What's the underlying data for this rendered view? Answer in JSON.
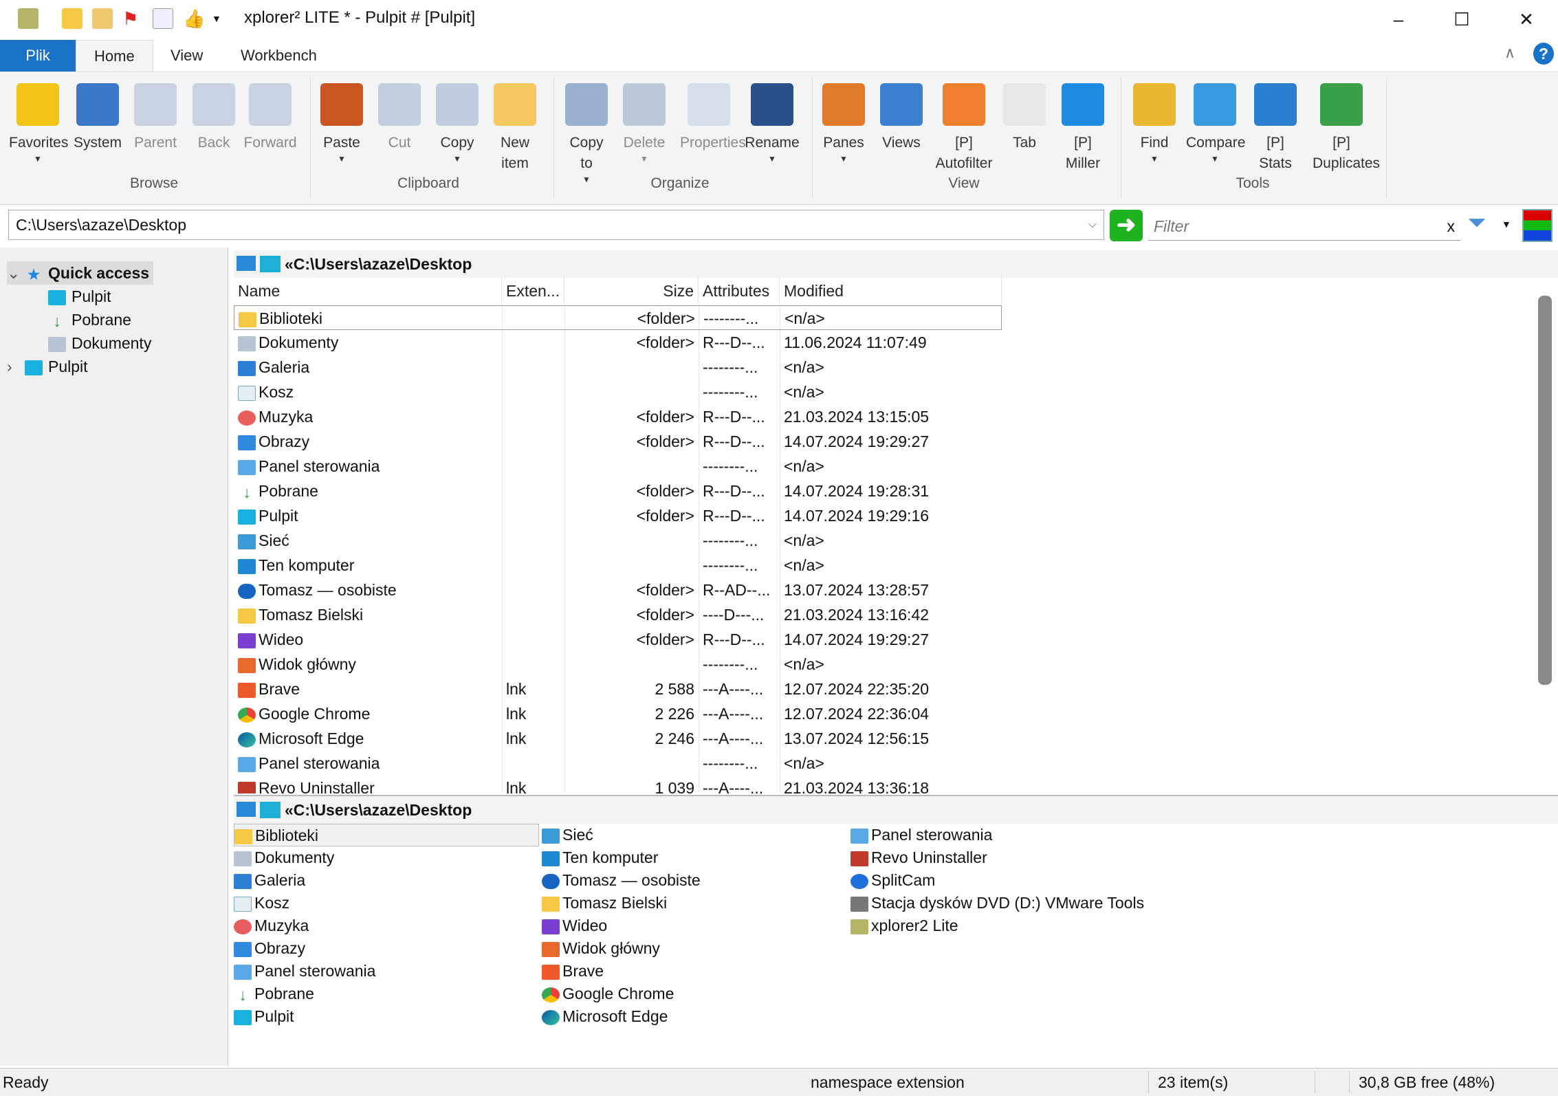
{
  "window": {
    "title": "xplorer² LITE * - Pulpit # [Pulpit]",
    "minimize": "–",
    "maximize": "☐",
    "close": "✕"
  },
  "tabs": [
    {
      "label": "Plik"
    },
    {
      "label": "Home",
      "active": true
    },
    {
      "label": "View"
    },
    {
      "label": "Workbench"
    }
  ],
  "ribbon": {
    "buttons": [
      {
        "label": "Favorites",
        "icon": "star-icon",
        "color": "#f2c418",
        "dropdown": true,
        "enabled": true
      },
      {
        "label": "System",
        "icon": "windows-icon",
        "color": "#3c78c8",
        "enabled": true
      },
      {
        "label": "Parent",
        "icon": "up-arrow-icon",
        "color": "#a8b8d0",
        "enabled": false
      },
      {
        "label": "Back",
        "icon": "back-arrow-icon",
        "color": "#a8b8d0",
        "enabled": false
      },
      {
        "label": "Forward",
        "icon": "forward-arrow-icon",
        "color": "#a8b8d0",
        "enabled": false
      },
      {
        "label": "Paste",
        "icon": "clipboard-icon",
        "color": "#c8561e",
        "dropdown": true,
        "enabled": true
      },
      {
        "label": "Cut",
        "icon": "scissors-icon",
        "color": "#9ab0cc",
        "enabled": false
      },
      {
        "label": "Copy",
        "icon": "copy-icon",
        "color": "#c0cde0",
        "dropdown": true,
        "enabled": true
      },
      {
        "label": "New\nitem",
        "icon": "new-folder-icon",
        "color": "#f5c860",
        "enabled": true
      },
      {
        "label": "Copy\nto",
        "icon": "copy-to-icon",
        "color": "#9ab0cc",
        "dropdown": true,
        "enabled": true
      },
      {
        "label": "Delete",
        "icon": "delete-x-icon",
        "color": "#8ea2c0",
        "dropdown": true,
        "enabled": false
      },
      {
        "label": "Properties",
        "icon": "properties-icon",
        "color": "#c0cde0",
        "enabled": false
      },
      {
        "label": "Rename",
        "icon": "rename-icon",
        "color": "#2a4f8a",
        "dropdown": true,
        "enabled": true
      },
      {
        "label": "Panes",
        "icon": "panes-icon",
        "color": "#e07a2a",
        "dropdown": true,
        "enabled": true
      },
      {
        "label": "Views",
        "icon": "views-icon",
        "color": "#3b7fd0",
        "enabled": true
      },
      {
        "label": "[P]\nAutofilter",
        "icon": "autofilter-icon",
        "color": "#f08030",
        "enabled": true
      },
      {
        "label": "Tab",
        "icon": "tab-icon",
        "color": "#e8e8e8",
        "enabled": true
      },
      {
        "label": "[P]\nMiller",
        "icon": "miller-icon",
        "color": "#1e8ae0",
        "enabled": true
      },
      {
        "label": "Find",
        "icon": "binoculars-icon",
        "color": "#e8b830",
        "dropdown": true,
        "enabled": true
      },
      {
        "label": "Compare",
        "icon": "compare-icon",
        "color": "#3a9ae0",
        "dropdown": true,
        "enabled": true
      },
      {
        "label": "[P]\nStats",
        "icon": "stats-pie-icon",
        "color": "#2a7fd0",
        "enabled": true
      },
      {
        "label": "[P]\nDuplicates",
        "icon": "duplicates-icon",
        "color": "#3aa04a",
        "enabled": true
      }
    ],
    "groups": [
      "Browse",
      "Clipboard",
      "Organize",
      "View",
      "Tools"
    ]
  },
  "address": {
    "value": "C:\\Users\\azaze\\Desktop"
  },
  "filter": {
    "placeholder": "Filter",
    "clear": "x"
  },
  "tree": [
    {
      "label": "Quick access",
      "icon": "star",
      "expander": "⌄",
      "bold": true,
      "selected": true
    },
    {
      "label": "Pulpit",
      "icon": "desktop",
      "child": true
    },
    {
      "label": "Pobrane",
      "icon": "download",
      "child": true
    },
    {
      "label": "Dokumenty",
      "icon": "doc",
      "child": true
    },
    {
      "label": "Pulpit",
      "icon": "desktop",
      "expander": "›"
    }
  ],
  "top_pane": {
    "path": "«C:\\Users\\azaze\\Desktop",
    "columns": [
      "Name",
      "Exten...",
      "Size",
      "Attributes",
      "Modified"
    ],
    "rows": [
      {
        "name": "Biblioteki",
        "icon": "folder",
        "ext": "",
        "size": "<folder>",
        "attr": "--------...",
        "modified": "<n/a>",
        "selected": true
      },
      {
        "name": "Dokumenty",
        "icon": "doc",
        "ext": "",
        "size": "<folder>",
        "attr": "R---D--...",
        "modified": "11.06.2024 11:07:49"
      },
      {
        "name": "Galeria",
        "icon": "gallery",
        "ext": "",
        "size": "",
        "attr": "--------...",
        "modified": "<n/a>"
      },
      {
        "name": "Kosz",
        "icon": "bin",
        "ext": "",
        "size": "",
        "attr": "--------...",
        "modified": "<n/a>"
      },
      {
        "name": "Muzyka",
        "icon": "music",
        "ext": "",
        "size": "<folder>",
        "attr": "R---D--...",
        "modified": "21.03.2024 13:15:05"
      },
      {
        "name": "Obrazy",
        "icon": "pictures",
        "ext": "",
        "size": "<folder>",
        "attr": "R---D--...",
        "modified": "14.07.2024 19:29:27"
      },
      {
        "name": "Panel sterowania",
        "icon": "control",
        "ext": "",
        "size": "",
        "attr": "--------...",
        "modified": "<n/a>"
      },
      {
        "name": "Pobrane",
        "icon": "download",
        "ext": "",
        "size": "<folder>",
        "attr": "R---D--...",
        "modified": "14.07.2024 19:28:31"
      },
      {
        "name": "Pulpit",
        "icon": "desktop",
        "ext": "",
        "size": "<folder>",
        "attr": "R---D--...",
        "modified": "14.07.2024 19:29:16"
      },
      {
        "name": "Sieć",
        "icon": "network",
        "ext": "",
        "size": "",
        "attr": "--------...",
        "modified": "<n/a>"
      },
      {
        "name": "Ten komputer",
        "icon": "pc",
        "ext": "",
        "size": "",
        "attr": "--------...",
        "modified": "<n/a>"
      },
      {
        "name": "Tomasz — osobiste",
        "icon": "onedrive",
        "ext": "",
        "size": "<folder>",
        "attr": "R--AD--...",
        "modified": "13.07.2024 13:28:57"
      },
      {
        "name": "Tomasz Bielski",
        "icon": "folder",
        "ext": "",
        "size": "<folder>",
        "attr": "----D---...",
        "modified": "21.03.2024 13:16:42"
      },
      {
        "name": "Wideo",
        "icon": "video",
        "ext": "",
        "size": "<folder>",
        "attr": "R---D--...",
        "modified": "14.07.2024 19:29:27"
      },
      {
        "name": "Widok główny",
        "icon": "home",
        "ext": "",
        "size": "",
        "attr": "--------...",
        "modified": "<n/a>"
      },
      {
        "name": "Brave",
        "icon": "brave",
        "ext": "lnk",
        "size": "2 588",
        "attr": "---A----...",
        "modified": "12.07.2024 22:35:20"
      },
      {
        "name": "Google Chrome",
        "icon": "chrome",
        "ext": "lnk",
        "size": "2 226",
        "attr": "---A----...",
        "modified": "12.07.2024 22:36:04"
      },
      {
        "name": "Microsoft Edge",
        "icon": "edge",
        "ext": "lnk",
        "size": "2 246",
        "attr": "---A----...",
        "modified": "13.07.2024 12:56:15"
      },
      {
        "name": "Panel sterowania",
        "icon": "control",
        "ext": "",
        "size": "",
        "attr": "--------...",
        "modified": "<n/a>"
      },
      {
        "name": "Revo Uninstaller",
        "icon": "revo",
        "ext": "lnk",
        "size": "1 039",
        "attr": "---A----...",
        "modified": "21.03.2024 13:36:18"
      }
    ]
  },
  "bottom_pane": {
    "path": "«C:\\Users\\azaze\\Desktop",
    "columns": [
      [
        {
          "name": "Biblioteki",
          "icon": "folder",
          "selected": true
        },
        {
          "name": "Dokumenty",
          "icon": "doc"
        },
        {
          "name": "Galeria",
          "icon": "gallery"
        },
        {
          "name": "Kosz",
          "icon": "bin"
        },
        {
          "name": "Muzyka",
          "icon": "music"
        },
        {
          "name": "Obrazy",
          "icon": "pictures"
        },
        {
          "name": "Panel sterowania",
          "icon": "control"
        },
        {
          "name": "Pobrane",
          "icon": "download"
        },
        {
          "name": "Pulpit",
          "icon": "desktop"
        }
      ],
      [
        {
          "name": "Sieć",
          "icon": "network"
        },
        {
          "name": "Ten komputer",
          "icon": "pc"
        },
        {
          "name": "Tomasz — osobiste",
          "icon": "onedrive"
        },
        {
          "name": "Tomasz Bielski",
          "icon": "folder"
        },
        {
          "name": "Wideo",
          "icon": "video"
        },
        {
          "name": "Widok główny",
          "icon": "home"
        },
        {
          "name": "Brave",
          "icon": "brave"
        },
        {
          "name": "Google Chrome",
          "icon": "chrome"
        },
        {
          "name": "Microsoft Edge",
          "icon": "edge"
        }
      ],
      [
        {
          "name": "Panel sterowania",
          "icon": "control"
        },
        {
          "name": "Revo Uninstaller",
          "icon": "revo"
        },
        {
          "name": "SplitCam",
          "icon": "splitcam"
        },
        {
          "name": "Stacja dysków DVD (D:) VMware Tools",
          "icon": "dvd"
        },
        {
          "name": "xplorer2 Lite",
          "icon": "xplorer"
        }
      ]
    ]
  },
  "status": {
    "left": "Ready",
    "type": "namespace extension",
    "count": "23 item(s)",
    "free": "30,8 GB free (48%)"
  }
}
